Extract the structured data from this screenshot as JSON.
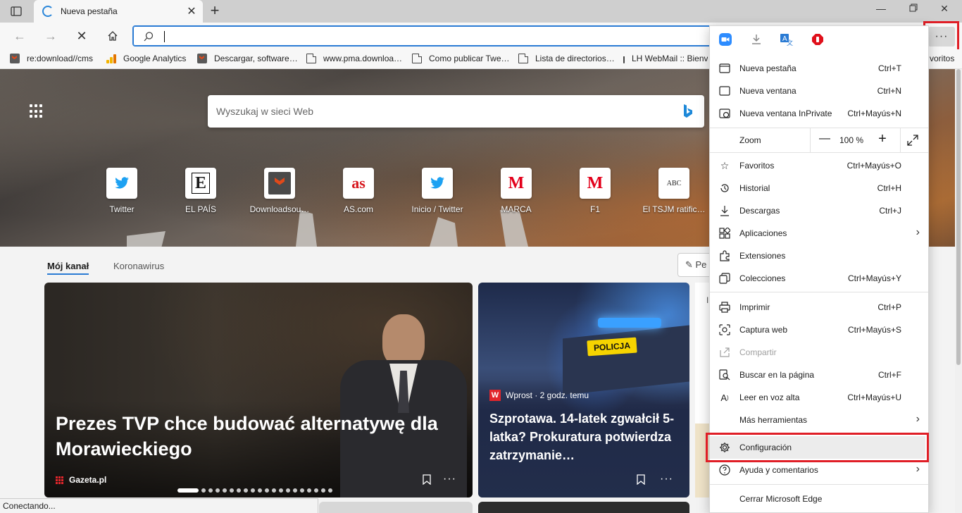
{
  "tab": {
    "title": "Nueva pestaña"
  },
  "favorites_bar": [
    {
      "label": "re:download//cms",
      "icon": "downloadsource-icon"
    },
    {
      "label": "Google Analytics",
      "icon": "analytics-icon"
    },
    {
      "label": "Descargar, software…",
      "icon": "downloadsource-icon"
    },
    {
      "label": "www.pma.downloa…",
      "icon": "page-icon"
    },
    {
      "label": "Como publicar Twe…",
      "icon": "page-icon"
    },
    {
      "label": "Lista de directorios…",
      "icon": "page-icon"
    },
    {
      "label": "LH WebMail :: Bienv",
      "icon": "page-icon"
    },
    {
      "label": "voritos",
      "icon": "none"
    }
  ],
  "newtab": {
    "search_placeholder": "Wyszukaj w sieci Web",
    "tiles": [
      {
        "label": "Twitter"
      },
      {
        "label": "EL PAÍS",
        "glyph": "E"
      },
      {
        "label": "Downloadsou…"
      },
      {
        "label": "AS.com",
        "glyph": "as"
      },
      {
        "label": "Inicio / Twitter"
      },
      {
        "label": "MARCA",
        "glyph": "M"
      },
      {
        "label": "F1",
        "glyph": "M"
      },
      {
        "label": "El TSJM ratific…",
        "glyph": "ABC"
      }
    ],
    "feed_tabs": [
      "Mój kanał",
      "Koronawirus"
    ],
    "personalize_label": "Pe",
    "card1": {
      "headline": "Prezes TVP chce budować alternatywę dla Morawieckiego",
      "source": "Gazeta.pl"
    },
    "card2": {
      "source": "Wprost · 2 godz. temu",
      "headline": "Szprotawa. 14-latek zgwałcił 5-latka? Prokuratura potwierdza zatrzymanie…",
      "badge": "POLICJA",
      "logo_letter": "W"
    },
    "card3_letter": "I"
  },
  "status_bar": "Conectando...",
  "menu": {
    "zoom": {
      "label": "Zoom",
      "value": "100 %"
    },
    "items": [
      {
        "label": "Nueva pestaña",
        "shortcut": "Ctrl+T"
      },
      {
        "label": "Nueva ventana",
        "shortcut": "Ctrl+N"
      },
      {
        "label": "Nueva ventana InPrivate",
        "shortcut": "Ctrl+Mayús+N"
      },
      {
        "label": "Favoritos",
        "shortcut": "Ctrl+Mayús+O"
      },
      {
        "label": "Historial",
        "shortcut": "Ctrl+H"
      },
      {
        "label": "Descargas",
        "shortcut": "Ctrl+J"
      },
      {
        "label": "Aplicaciones",
        "shortcut": ""
      },
      {
        "label": "Extensiones",
        "shortcut": ""
      },
      {
        "label": "Colecciones",
        "shortcut": "Ctrl+Mayús+Y"
      },
      {
        "label": "Imprimir",
        "shortcut": "Ctrl+P"
      },
      {
        "label": "Captura web",
        "shortcut": "Ctrl+Mayús+S"
      },
      {
        "label": "Compartir",
        "shortcut": ""
      },
      {
        "label": "Buscar en la página",
        "shortcut": "Ctrl+F"
      },
      {
        "label": "Leer en voz alta",
        "shortcut": "Ctrl+Mayús+U"
      },
      {
        "label": "Más herramientas",
        "shortcut": ""
      },
      {
        "label": "Configuración",
        "shortcut": ""
      },
      {
        "label": "Ayuda y comentarios",
        "shortcut": ""
      },
      {
        "label": "Cerrar Microsoft Edge",
        "shortcut": ""
      }
    ]
  },
  "colors": {
    "accent": "#2a7bd4",
    "highlight": "#e01e26",
    "marca": "#e3001b",
    "twitter": "#1da1f2"
  }
}
